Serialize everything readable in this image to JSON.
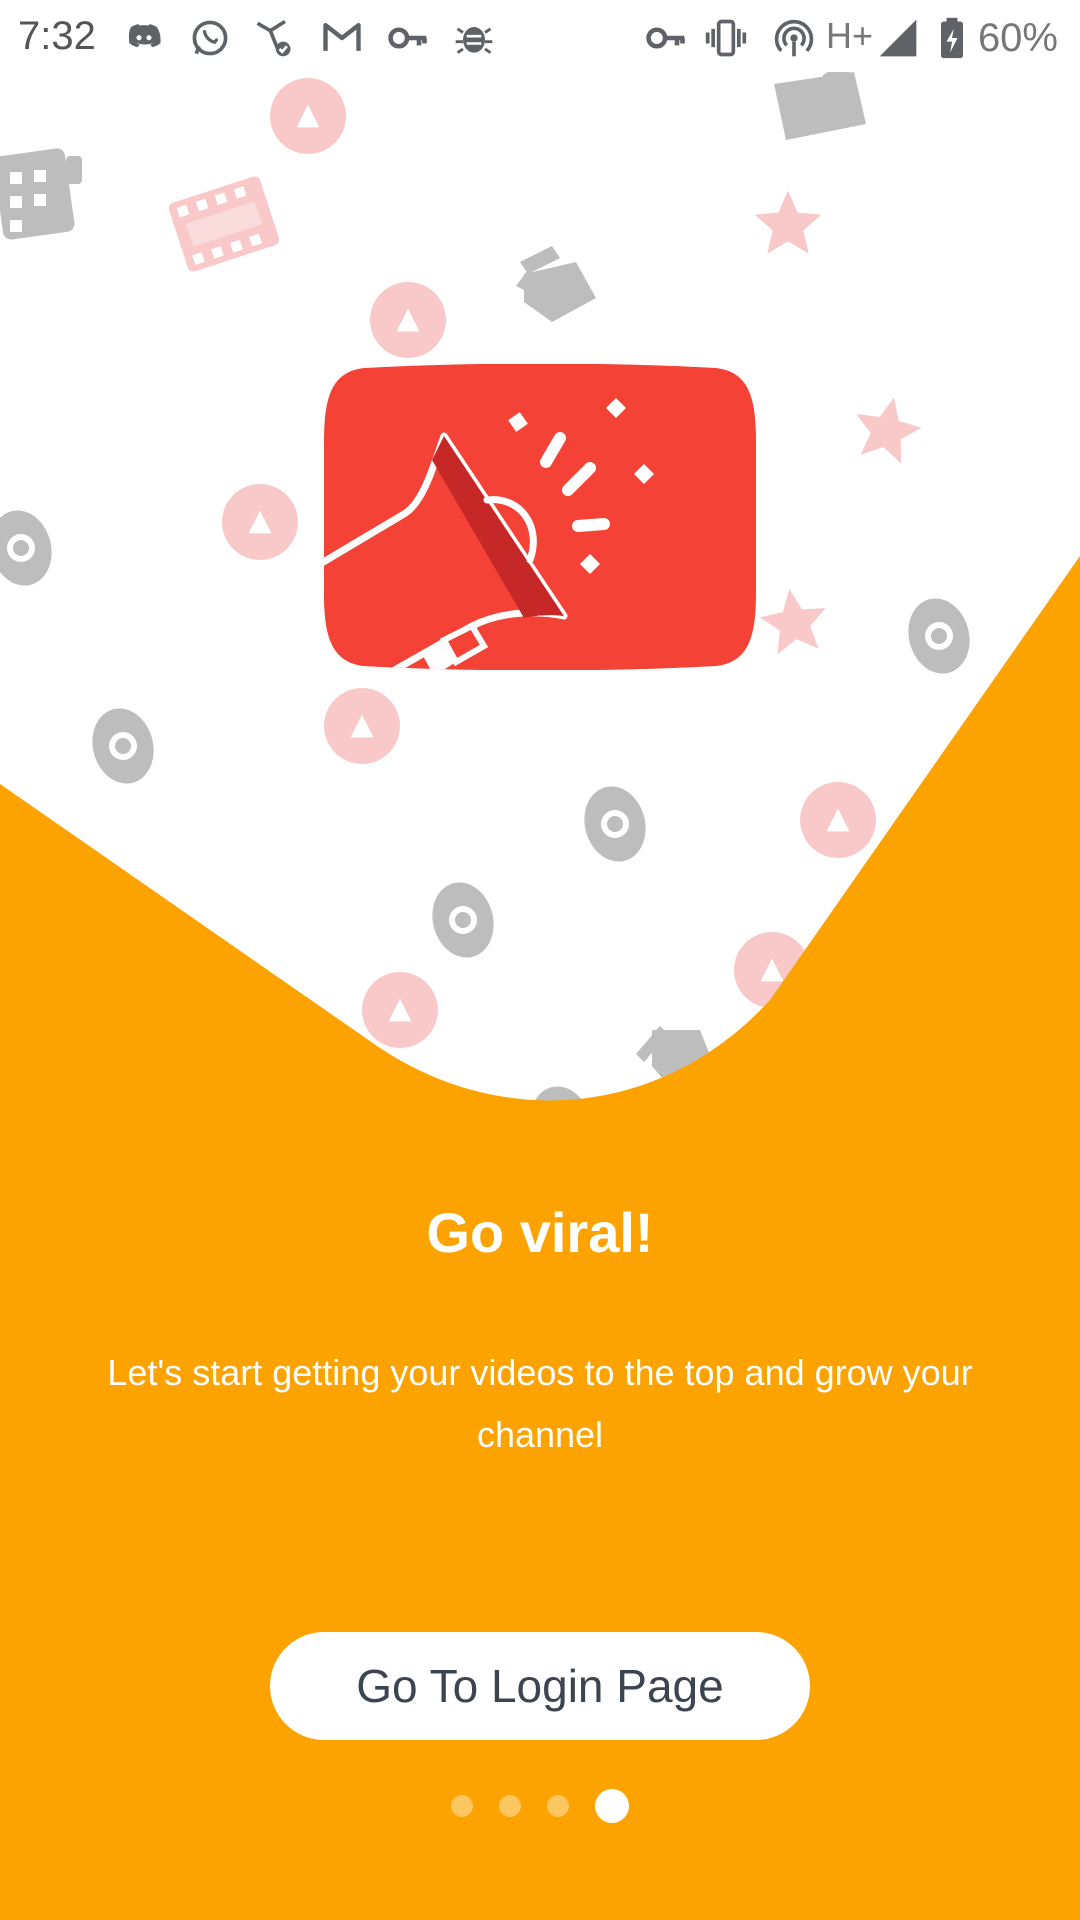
{
  "status_bar": {
    "time": "7:32",
    "network_type": "H+",
    "battery_percent": "60%",
    "notification_icons": [
      "discord-icon",
      "whatsapp-icon",
      "share-check-icon",
      "gmail-icon",
      "vpn-key-icon",
      "bug-icon"
    ],
    "system_icons": [
      "vpn-key-icon",
      "vibrate-icon",
      "hotspot-icon",
      "signal-icon",
      "battery-charging-icon"
    ]
  },
  "hero": {
    "logo_icon": "megaphone-play-logo",
    "background_icons": [
      "play-circle-icon",
      "film-strip-icon",
      "clapperboard-icon",
      "star-icon",
      "eye-icon"
    ]
  },
  "onboarding": {
    "title": "Go viral!",
    "description": "Let's start getting your videos to the top and grow your channel",
    "cta_label": "Go To Login Page",
    "page_count": 4,
    "current_page": 4
  },
  "colors": {
    "accent_orange": "#FCA301",
    "logo_red": "#F44336",
    "deco_pink": "#F9C9C9",
    "deco_gray": "#BDBDBD"
  }
}
